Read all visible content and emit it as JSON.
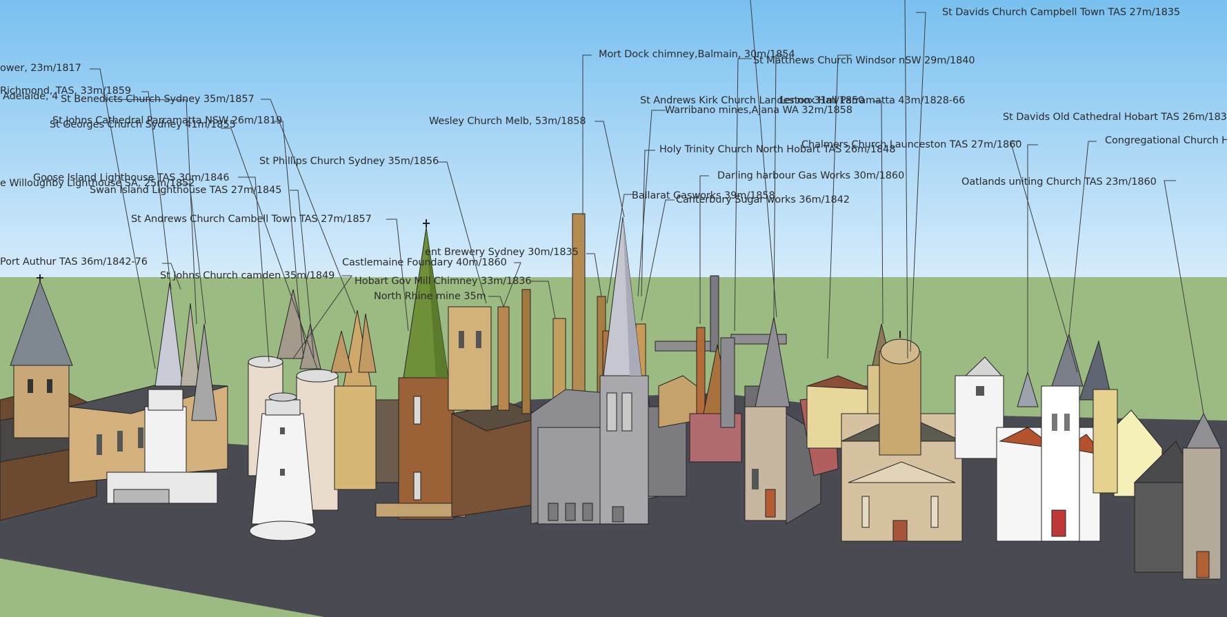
{
  "app": "3D model viewport",
  "colors": {
    "sky_top": "#79c0f0",
    "sky_bottom": "#d6ecfb",
    "grass": "#9cbb82",
    "ground": "#4a4a52",
    "leader": "#3a3a3a"
  },
  "labels": [
    {
      "id": "l01",
      "text": "ower, 23m/1817"
    },
    {
      "id": "l02",
      "text": "Richmond, TAS, 33m/1859"
    },
    {
      "id": "l03",
      "text": "Adelaide, 4"
    },
    {
      "id": "l04",
      "text": "St Benedicts Church Sydney 35m/1857"
    },
    {
      "id": "l05",
      "text": "St Johns Cathedral Parramatta NSW 26m/1819"
    },
    {
      "id": "l06",
      "text": "St Georges Church Sydney 41m/1855"
    },
    {
      "id": "l07",
      "text": "St Phillips Church Sydney 35m/1856"
    },
    {
      "id": "l08",
      "text": "Goose Island Lighthouse TAS 30m/1846"
    },
    {
      "id": "l09",
      "text": "e Willoughby Lighthouse SA, 25m/1852"
    },
    {
      "id": "l10",
      "text": "Swan Island Lighthouse TAS 27m/1845"
    },
    {
      "id": "l11",
      "text": "St Andrews Church Cambell Town TAS 27m/1857"
    },
    {
      "id": "l12",
      "text": "Port Authur TAS 36m/1842-76"
    },
    {
      "id": "l13",
      "text": "St Johns Church camden 35m/1849"
    },
    {
      "id": "l14",
      "text": "Castlemaine Foundary 40m/1860"
    },
    {
      "id": "l15",
      "text": "Hobart Gov Mill Chimney 33m/1836"
    },
    {
      "id": "l16",
      "text": "North Rhine mine 35m"
    },
    {
      "id": "l17",
      "text": "ent Brewery Sydney 30m/1835"
    },
    {
      "id": "l18",
      "text": "Wesley Church Melb, 53m/1858"
    },
    {
      "id": "l19",
      "text": "Mort Dock chimney,Balmain, 30m/1854"
    },
    {
      "id": "l20",
      "text": "St Matthews Church Windsor nSW 29m/1840"
    },
    {
      "id": "l21",
      "text": "St Davids Church Campbell Town TAS 27m/1835"
    },
    {
      "id": "l22",
      "text": "St Andrews Kirk Church Landeston 31m/1850"
    },
    {
      "id": "l23",
      "text": "Lennox Hall Parramatta 43m/1828-66"
    },
    {
      "id": "l24",
      "text": "Warribano mines,Ajana WA 32m/1858"
    },
    {
      "id": "l25",
      "text": "Holy Trinity Church North Hobart TAS 26m/1848"
    },
    {
      "id": "l26",
      "text": "Chalmers Church Launceston TAS 27m/1860"
    },
    {
      "id": "l27",
      "text": "St Davids Old Cathedral Hobart TAS 26m/183"
    },
    {
      "id": "l28",
      "text": "Congregational Church H"
    },
    {
      "id": "l29",
      "text": "Darling harbour Gas Works 30m/1860"
    },
    {
      "id": "l30",
      "text": "Oatlands uniting Church TAS 23m/1860"
    },
    {
      "id": "l31",
      "text": "Ballarat Gasworks 39m/1858"
    },
    {
      "id": "l32",
      "text": "Canterbury Sugar works 36m/1842"
    }
  ]
}
